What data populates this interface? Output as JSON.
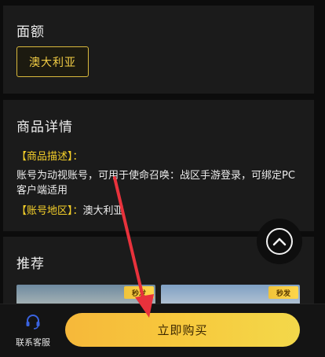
{
  "denomination": {
    "title": "面额",
    "selected": "澳大利亚"
  },
  "details": {
    "title": "商品详情",
    "desc_label": "【商品描述】：",
    "desc_text_line1": "账号为动视账号，可用于使命召唤：战区手游登录，可绑定PC",
    "desc_text_line2": "客户端适用",
    "region_label": "【账号地区】：",
    "region_value": "澳大利亚"
  },
  "recommend": {
    "title": "推荐",
    "items": [
      {
        "badge": "秒发"
      },
      {
        "badge": "秒发"
      }
    ]
  },
  "bottom": {
    "service_label": "联系客服",
    "buy_label": "立即购买"
  },
  "colors": {
    "accent": "#f7c93d",
    "highlight": "#f5d02a",
    "annotation_arrow": "#e8323c"
  },
  "icons": {
    "service": "headset-icon",
    "scroll_top": "chevron-up-icon"
  }
}
